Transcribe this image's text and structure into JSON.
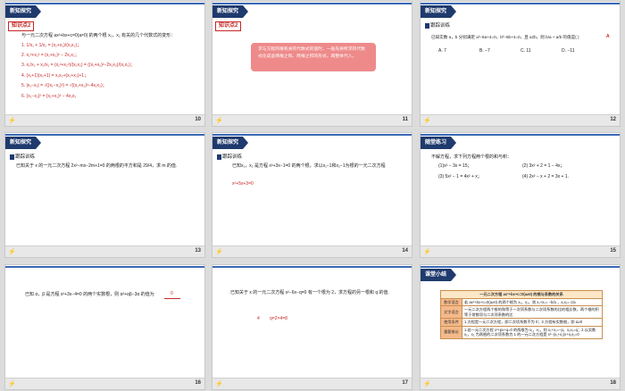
{
  "slides": [
    {
      "number": "10",
      "header": "新知探究",
      "tag": "知识点2",
      "intro": "与一元二次方程 ax²+bx+c=0(a≠0) 的两个根 x₁，x₂ 有关的几个代数式的变形：",
      "items": [
        "1. 1/x₁ + 1/x₂ = (x₁+x₂)/(x₁x₂)；",
        "2. x₁²+x₂² = (x₁+x₂)² − 2x₁x₂；",
        "3. x₁/x₂ + x₂/x₁ = (x₁²+x₂²)/(x₁x₂) = ((x₁+x₂)²−2x₁x₂)/(x₁x₂)；",
        "4. (x₁+1)(x₂+1) = x₁x₂+(x₁+x₂)+1；",
        "5. |x₁−x₂| = √((x₁−x₂)²) = √((x₁+x₂)²−4x₁x₂)；",
        "6. (x₁−x₂)² = (x₁+x₂)² − 4x₁x₂"
      ]
    },
    {
      "number": "11",
      "header": "新知探究",
      "tag": "知识点2",
      "note": "求与方程的根有关的代数式的值时，一般先将所求的代数式化成含两根之和、两根之积的形式，再整体代入。"
    },
    {
      "number": "12",
      "header": "新知探究",
      "sub": "跟踪训练",
      "question": "已知实数 a，b 分别满足 a²−6a+4=0，b²−6b+4=0，且 a≠b，则 b/a + a/b 的值是(   )",
      "answer": "A",
      "options": [
        "A. 7",
        "B. −7",
        "C. 11",
        "D. −11"
      ]
    },
    {
      "number": "13",
      "header": "新知探究",
      "sub": "跟踪训练",
      "question": "已知关于 x 的一元二次方程 2x²−mx−2m+1=0 的两根的平方和是 29/4，求 m 的值."
    },
    {
      "number": "14",
      "header": "新知探究",
      "sub": "跟踪训练",
      "question": "已知x₁，x₂ 是方程 x²+3x−1=0 的两个根，求以x₁−1和x₂−1为根的一元二次方程",
      "answer": "x²+5x+3=0"
    },
    {
      "number": "15",
      "header": "随堂练习",
      "question": "不解方程，求下列方程两个根的和与积：",
      "items": [
        "(1)x² − 3x = 15；",
        "(2) 3x² + 2 = 1 − 4x；",
        "(3) 5x² − 1 = 4x² + x；",
        "(4) 2x² − x + 2 = 3x + 1."
      ]
    },
    {
      "number": "16",
      "question": "已知 α，β 是方程 x²+3x−4=0 的两个实数根，则 α²+αβ−3α 的值为",
      "answer": "0"
    },
    {
      "number": "17",
      "question": "已知关于 x 的一元二次方程 x²−6x−q=0 有一个根为 2，求方程的另一根和 q 的值.",
      "answer1": "4",
      "answer2": "q=2×4=8"
    },
    {
      "number": "18",
      "header": "课堂小结",
      "table_title": "一元二次方程 ax²+bx+c=0(a≠0) 的根与系数的关系",
      "rows": [
        {
          "label": "数学语言",
          "text": "若 ax²+bx+c=0(a≠0) 的两个根为 x₁，x₂，则 x₁+x₂= −b/a ，x₁x₂= c/a"
        },
        {
          "label": "文字语言",
          "text": "一元二次方程两个根的和等于一次项系数与二次项系数的比的相反数，两个根的积等于常数项与二次项系数的比"
        },
        {
          "label": "使用条件",
          "text": "1.方程是一元二次方程，即二次项系数不为 0；2.方程有实数根，即 Δ≥0"
        },
        {
          "label": "重要推论",
          "text": "1.若一元二次方程 x²+px+q=0 的两根为 x₁，x₂，则 x₁+x₂=−p，x₁x₂=q；2.以实数 x₁，x₂ 为两根的二次项系数为 1 的一元二次方程是 x²−(x₁+x₂)x+x₁x₂=0"
        }
      ]
    }
  ]
}
